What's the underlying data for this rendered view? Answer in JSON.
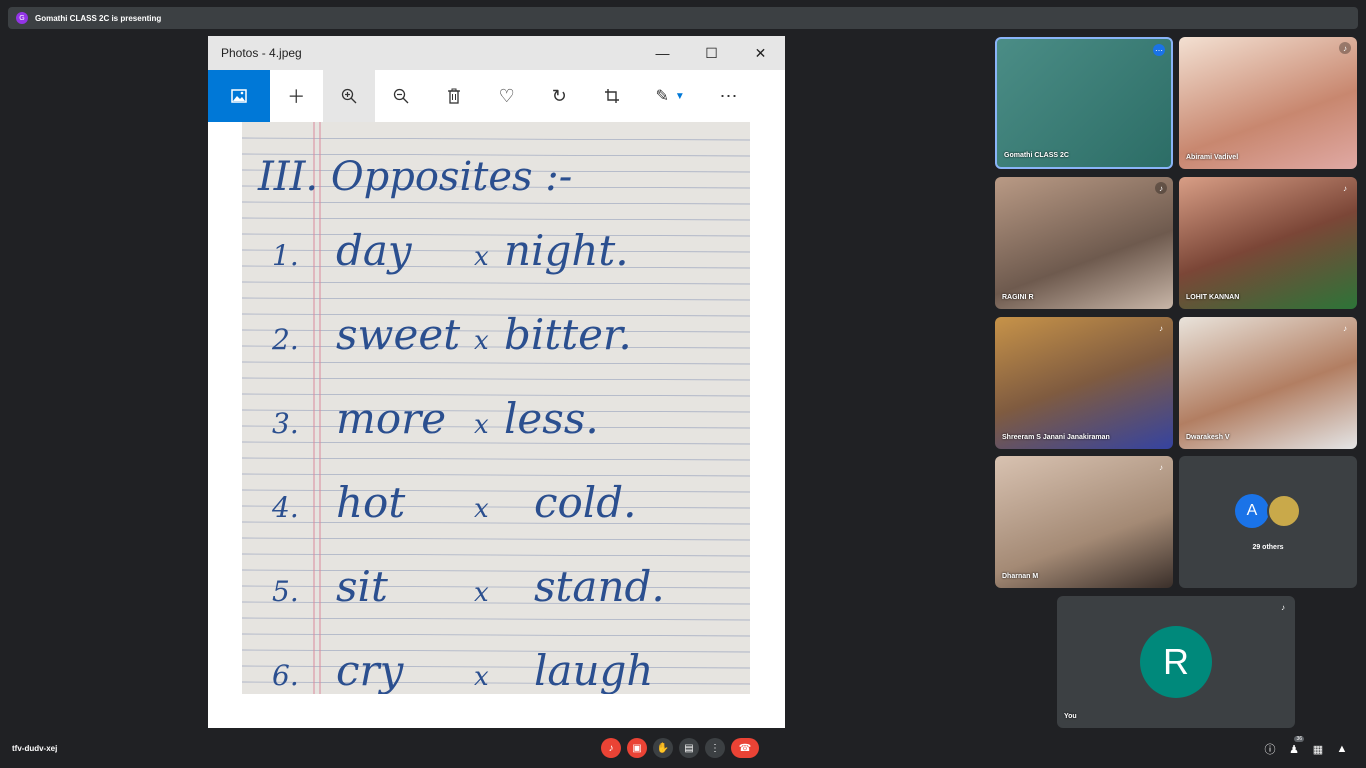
{
  "presentation_bar": {
    "avatar_letter": "G",
    "text": "Gomathi CLASS 2C is presenting"
  },
  "photos_window": {
    "title": "Photos - 4.jpeg",
    "worksheet": {
      "heading": "III. Opposites :-",
      "lines": [
        {
          "num": "1.",
          "word": "day",
          "opposite": "night."
        },
        {
          "num": "2.",
          "word": "sweet",
          "opposite": "bitter."
        },
        {
          "num": "3.",
          "word": "more",
          "opposite": "less."
        },
        {
          "num": "4.",
          "word": "hot",
          "opposite": "cold."
        },
        {
          "num": "5.",
          "word": "sit",
          "opposite": "stand."
        },
        {
          "num": "6.",
          "word": "cry",
          "opposite": "laugh"
        }
      ],
      "separator": "x"
    }
  },
  "participants": [
    {
      "name": "Gomathi CLASS 2C"
    },
    {
      "name": "Abirami Vadivel"
    },
    {
      "name": "RAGINI R"
    },
    {
      "name": "LOHIT KANNAN"
    },
    {
      "name": "Shreeram S Janani Janakiraman"
    },
    {
      "name": "Dwarakesh V"
    },
    {
      "name": "Dharnan M"
    }
  ],
  "others_tile": {
    "avatar_letter": "A",
    "label": "29 others"
  },
  "self_tile": {
    "avatar_letter": "R",
    "label": "You"
  },
  "bottom_bar": {
    "meeting_code": "tfv-dudv-xej",
    "people_count": "36"
  },
  "colors": {
    "accent": "#0078d7",
    "end_call": "#ea4335",
    "self_avatar": "#00897b",
    "others_avatar": "#1a73e8"
  }
}
